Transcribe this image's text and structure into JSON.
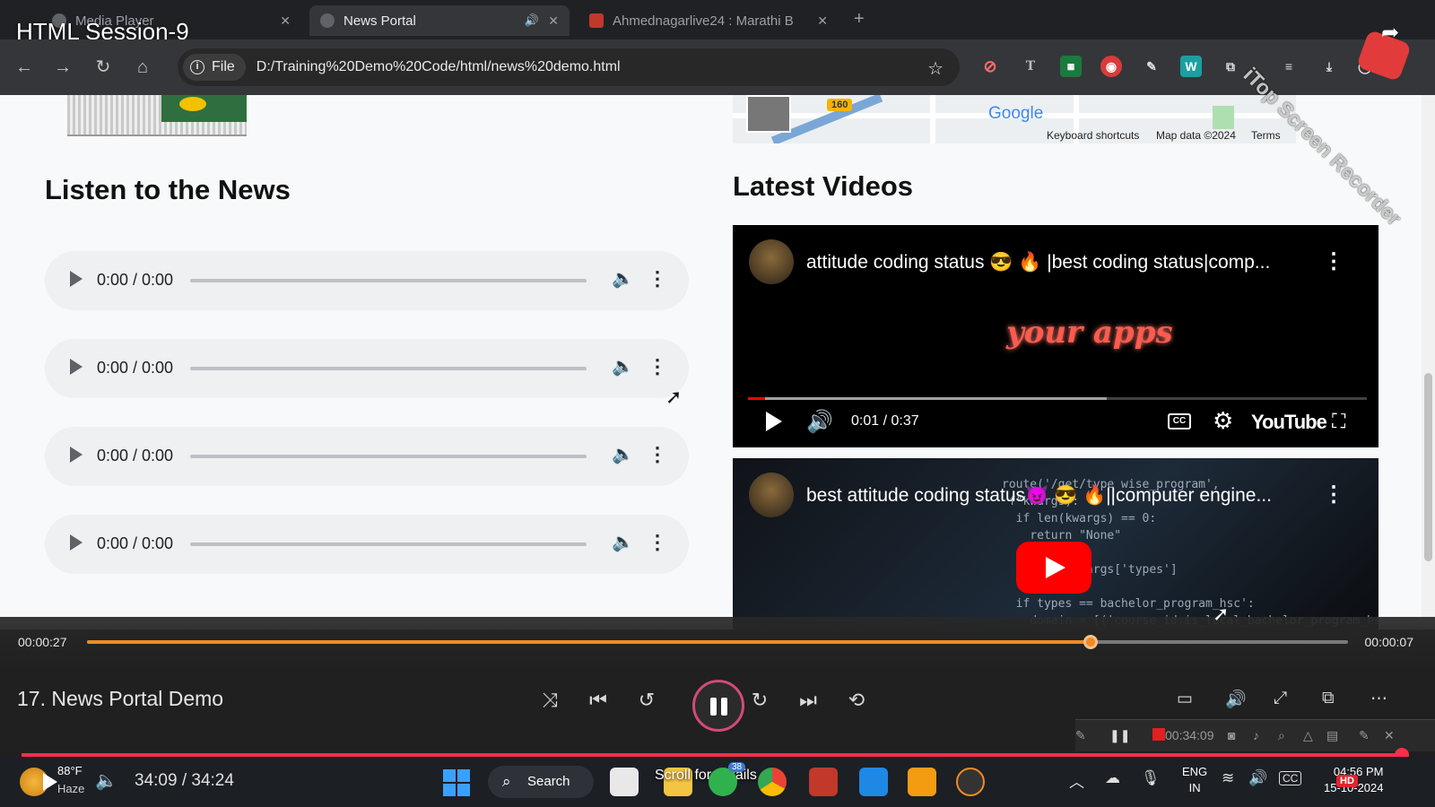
{
  "recording": {
    "title": "HTML Session-9",
    "watermark": "iTop Screen Recorder"
  },
  "browser": {
    "tabs": [
      {
        "label": "Media Player",
        "active": false
      },
      {
        "label": "News Portal",
        "active": true
      },
      {
        "label": "Ahmednagarlive24 : Marathi B",
        "active": false
      }
    ],
    "site_chip": "File",
    "url": "D:/Training%20Demo%20Code/html/news%20demo.html"
  },
  "page": {
    "listen_heading": "Listen to the News",
    "audio_players": [
      {
        "time": "0:00 / 0:00"
      },
      {
        "time": "0:00 / 0:00"
      },
      {
        "time": "0:00 / 0:00"
      },
      {
        "time": "0:00 / 0:00"
      }
    ],
    "map": {
      "route_shield": "160",
      "logo": "Google",
      "keyboard_shortcuts": "Keyboard shortcuts",
      "map_data": "Map data ©2024",
      "terms": "Terms"
    },
    "videos_heading": "Latest Videos",
    "videos": [
      {
        "title": "attitude coding status 😎 🔥 |best coding status|comp...",
        "overlay_text": "your apps",
        "time": "0:01 / 0:37",
        "brand": "YouTube",
        "progress": 0.027
      },
      {
        "title": "best attitude coding status😈 😎 🔥||computer engine..."
      }
    ]
  },
  "player": {
    "current_time": "00:00:27",
    "remaining_time": "00:00:07",
    "progress": 0.796,
    "track_title": "17. News Portal Demo",
    "accent": "#f08a24"
  },
  "recorder_bar": {
    "elapsed": "00:34:09"
  },
  "taskbar": {
    "temperature": "88°F",
    "weather": "Haze",
    "media_time": "34:09 / 34:24",
    "search_label": "Search",
    "scroll_hint": "Scroll for details",
    "badge_count": "38",
    "language_top": "ENG",
    "language_bottom": "IN",
    "clock_time": "04:56 PM",
    "clock_date": "15-10-2024",
    "hd_badge": "HD"
  }
}
